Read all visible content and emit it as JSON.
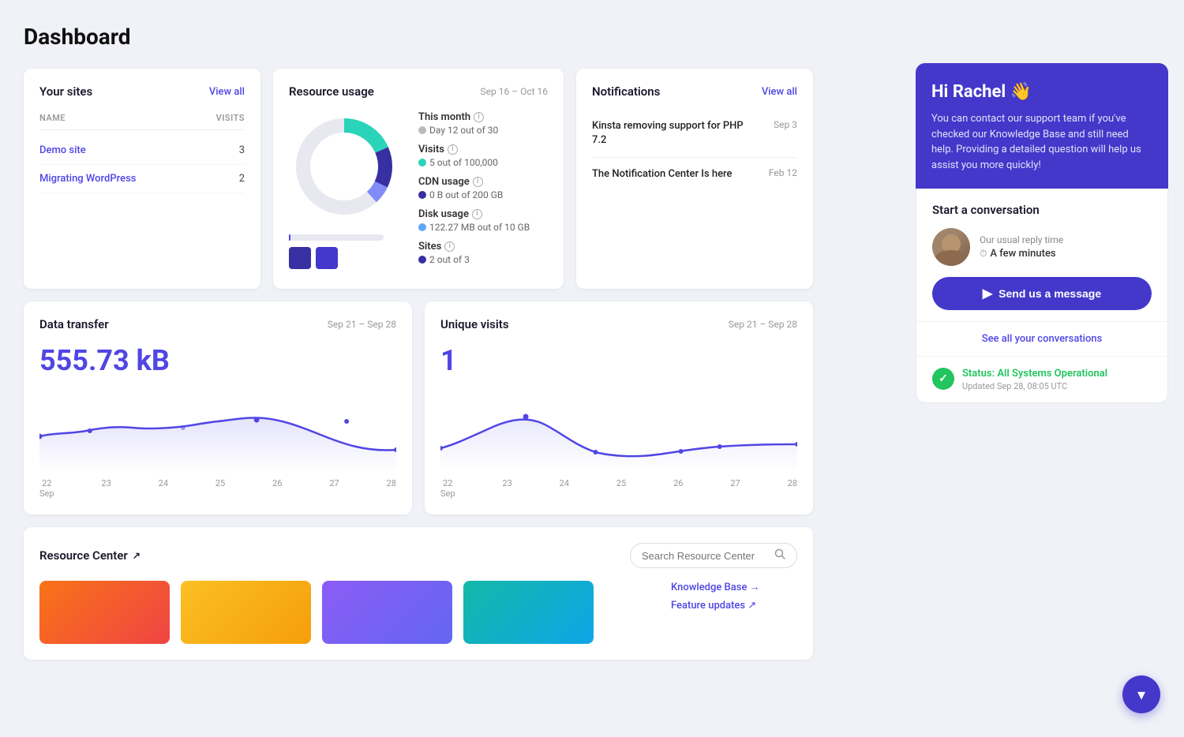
{
  "page": {
    "title": "Dashboard"
  },
  "sites_card": {
    "title": "Your sites",
    "view_all": "View all",
    "col_name": "NAME",
    "col_visits": "VISITS",
    "sites": [
      {
        "name": "Demo site",
        "visits": "3"
      },
      {
        "name": "Migrating WordPress",
        "visits": "2"
      }
    ]
  },
  "resource_card": {
    "title": "Resource usage",
    "date_range": "Sep 16 – Oct 16",
    "stats": [
      {
        "label": "This month",
        "value": "Day 12 out of 30",
        "dot": "gray"
      },
      {
        "label": "Visits",
        "value": "5 out of 100,000",
        "dot": "teal"
      },
      {
        "label": "CDN usage",
        "value": "0 B out of 200 GB",
        "dot": "navy"
      },
      {
        "label": "Disk usage",
        "value": "122.27 MB out of 10 GB",
        "dot": "light-blue"
      },
      {
        "label": "Sites",
        "value": "2 out of 3",
        "dot": "navy"
      }
    ]
  },
  "notifications_card": {
    "title": "Notifications",
    "view_all": "View all",
    "items": [
      {
        "text": "Kinsta removing support for PHP 7.2",
        "date": "Sep 3"
      },
      {
        "text": "The Notification Center Is here",
        "date": "Feb 12"
      }
    ]
  },
  "data_transfer_card": {
    "title": "Data transfer",
    "date_range": "Sep 21 – Sep 28",
    "value": "555.73 kB",
    "labels": [
      "22",
      "23",
      "24",
      "25",
      "26",
      "27",
      "28"
    ],
    "label_sub": "Sep"
  },
  "unique_visits_card": {
    "title": "Unique visits",
    "date_range": "Sep 21 – Sep 28",
    "value": "1",
    "labels": [
      "22",
      "23",
      "24",
      "25",
      "26",
      "27",
      "28"
    ],
    "label_sub": "Sep"
  },
  "resource_center": {
    "title": "Resource Center",
    "search_placeholder": "Search Resource Center",
    "links": [
      {
        "label": "Knowledge Base →"
      },
      {
        "label": "Feature updates ↗"
      }
    ]
  },
  "chat_panel": {
    "greeting": "Hi Rachel",
    "wave": "👋",
    "description": "You can contact our support team if you've checked our Knowledge Base and still need help. Providing a detailed question will help us assist you more quickly!",
    "start_conversation": "Start a conversation",
    "reply_label": "Our usual reply time",
    "reply_time": "A few minutes",
    "send_btn": "Send us a message",
    "see_conversations": "See all your conversations",
    "status_label": "Status: All Systems Operational",
    "status_updated": "Updated Sep 28, 08:05 UTC"
  },
  "float_btn": "▾",
  "colors": {
    "accent": "#5046e5",
    "purple_dark": "#4338ca"
  }
}
